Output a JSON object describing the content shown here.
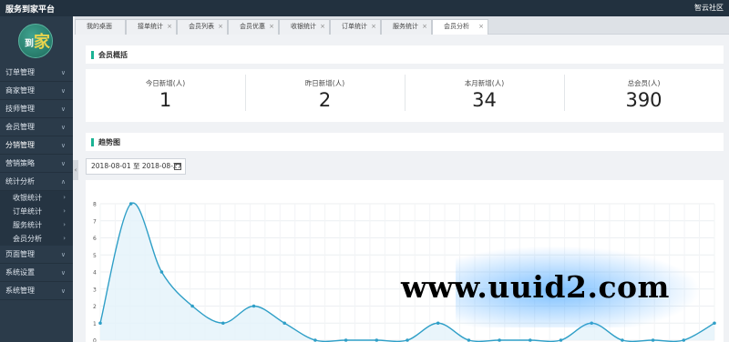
{
  "app": {
    "title": "服务到家平台",
    "user_menu": "智云社区"
  },
  "logo": {
    "char1": "到",
    "char2": "家"
  },
  "sidebar": {
    "items": [
      {
        "label": "订单管理",
        "chev": "∨"
      },
      {
        "label": "商家管理",
        "chev": "∨"
      },
      {
        "label": "技师管理",
        "chev": "∨"
      },
      {
        "label": "会员管理",
        "chev": "∨"
      },
      {
        "label": "分销管理",
        "chev": "∨"
      },
      {
        "label": "营销策略",
        "chev": "∨"
      },
      {
        "label": "统计分析",
        "chev": "∧"
      }
    ],
    "sub_items": [
      {
        "label": "收银统计",
        "chev": "›"
      },
      {
        "label": "订单统计",
        "chev": "›"
      },
      {
        "label": "服务统计",
        "chev": "›"
      },
      {
        "label": "会员分析",
        "chev": "›"
      }
    ],
    "items_after": [
      {
        "label": "页面管理",
        "chev": "∨"
      },
      {
        "label": "系统设置",
        "chev": "∨"
      },
      {
        "label": "系统管理",
        "chev": "∨"
      }
    ]
  },
  "tabs": [
    {
      "label": "我的桌面",
      "close": ""
    },
    {
      "label": "接单统计",
      "close": "×"
    },
    {
      "label": "会员列表",
      "close": "×"
    },
    {
      "label": "会员优惠",
      "close": "×"
    },
    {
      "label": "收银统计",
      "close": "×"
    },
    {
      "label": "订单统计",
      "close": "×"
    },
    {
      "label": "服务统计",
      "close": "×"
    },
    {
      "label": "会员分析",
      "close": "×"
    }
  ],
  "overview": {
    "title": "会员概括",
    "stats": [
      {
        "label": "今日新增(人)",
        "value": "1"
      },
      {
        "label": "昨日新增(人)",
        "value": "2"
      },
      {
        "label": "本月新增(人)",
        "value": "34"
      },
      {
        "label": "总会员(人)",
        "value": "390"
      }
    ]
  },
  "trend": {
    "title": "趋势图",
    "date_range": "2018-08-01 至 2018-08-27"
  },
  "chart_data": {
    "type": "area",
    "ylim": [
      0,
      8
    ],
    "yticks": [
      "0",
      "1",
      "2",
      "3",
      "4",
      "5",
      "6",
      "7",
      "8"
    ],
    "values": [
      1,
      8,
      4,
      2,
      1,
      2,
      1,
      0,
      0,
      0,
      0,
      1,
      0,
      0,
      0,
      0,
      1,
      0,
      0,
      0,
      1
    ],
    "grid": true,
    "line_color": "#2f9fc7",
    "fill_color": "#e3f2fa"
  },
  "watermark": {
    "text": "www.uuid2.com"
  },
  "collapse_handle": {
    "glyph": "‹"
  },
  "colors": {
    "accent": "#1ab394",
    "topbar": "#22313f",
    "sidebar": "#2b3b4a"
  }
}
